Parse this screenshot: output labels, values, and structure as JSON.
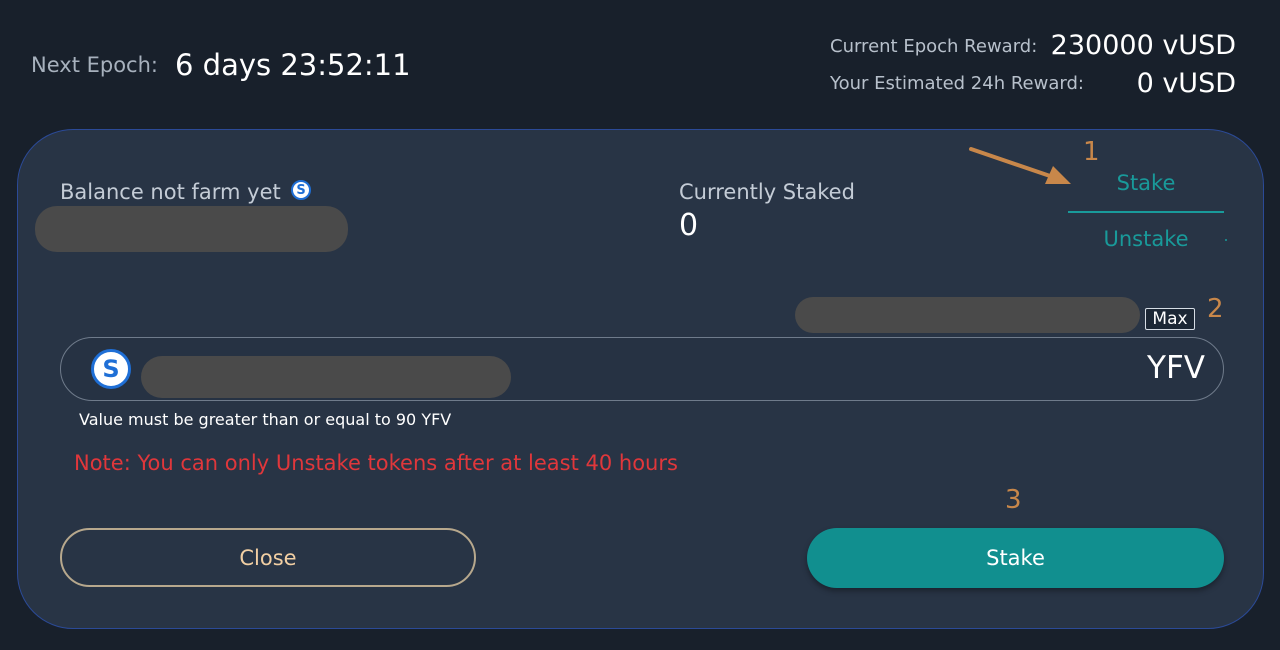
{
  "header": {
    "next_epoch_label": "Next Epoch:",
    "next_epoch_value": "6 days 23:52:11",
    "current_epoch_reward_label": "Current Epoch Reward:",
    "current_epoch_reward_value": "230000 vUSD",
    "estimated_reward_label": "Your Estimated 24h Reward:",
    "estimated_reward_value": "0 vUSD"
  },
  "modal": {
    "balance_label": "Balance not farm yet",
    "currently_staked_label": "Currently Staked",
    "currently_staked_value": "0",
    "tabs": [
      {
        "label": "Stake",
        "active": true
      },
      {
        "label": "Unstake",
        "active": false
      }
    ],
    "max_label": "Max",
    "token_glyph": "S",
    "amount_unit": "YFV",
    "hint": "Value must be greater than or equal to 90 YFV",
    "note": "Note: You can only Unstake tokens after at least 40 hours",
    "close_label": "Close",
    "stake_label": "Stake"
  },
  "annotations": [
    "1",
    "2",
    "3"
  ],
  "colors": {
    "background": "#18202b",
    "modal": "#283445",
    "accent_teal": "#118f8f",
    "note_red": "#e0373b",
    "annotation_orange": "#c8874a"
  },
  "icons": {
    "token": "yfv-token-icon",
    "arrow": "annotation-arrow-icon"
  }
}
